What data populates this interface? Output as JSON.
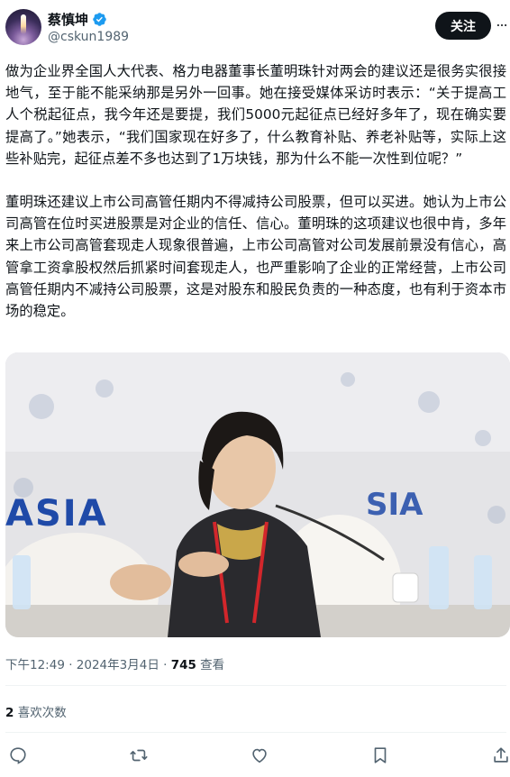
{
  "author": {
    "display_name": "蔡慎坤",
    "handle": "@cskun1989",
    "verified": true
  },
  "header": {
    "follow_label": "关注"
  },
  "post": {
    "paragraphs": [
      "做为企业界全国人大代表、格力电器董事长董明珠针对两会的建议还是很务实很接地气，至于能不能采纳那是另外一回事。她在接受媒体采访时表示：“关于提高工人个税起征点，我今年还是要提，我们5000元起征点已经好多年了，现在确实要提高了。”她表示，“我们国家现在好多了，什么教育补贴、养老补贴等，实际上这些补贴完，起征点差不多也达到了1万块钱，那为什么不能一次性到位呢？”",
      "董明珠还建议上市公司高管任期内不得减持公司股票，但可以买进。她认为上市公司高管在位时买进股票是对企业的信任、信心。董明珠的这项建议也很中肯，多年来上市公司高管套现走人现象很普遍，上市公司高管对公司发展前景没有信心，高管拿工资拿股权然后抓紧时间套现走人，也严重影响了企业的正常经营，上市公司高管任期内不减持公司股票，这是对股东和股民负责的一种态度，也有利于资本市场的稳定。"
    ],
    "image_banner_text": "ASIA"
  },
  "meta": {
    "time": "下午12:49",
    "separator": " · ",
    "date": "2024年3月4日",
    "views": "745",
    "views_label": " 查看"
  },
  "likes": {
    "count": "2",
    "label": " 喜欢次数"
  },
  "actions": {
    "icons": [
      "reply-icon",
      "repost-icon",
      "like-icon",
      "bookmark-icon",
      "share-icon"
    ]
  },
  "colors": {
    "text": "#0f1419",
    "muted": "#536471",
    "verified": "#1d9bf0",
    "button": "#0f1419"
  }
}
